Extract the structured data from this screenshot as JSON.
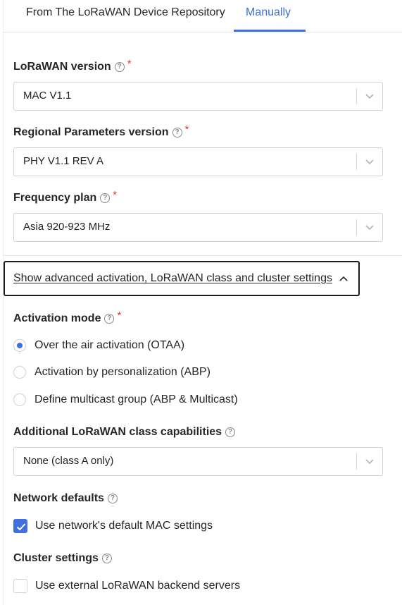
{
  "tabs": [
    {
      "label": "From The LoRaWAN Device Repository",
      "active": false
    },
    {
      "label": "Manually",
      "active": true
    }
  ],
  "fields": {
    "lorawan_version": {
      "label": "LoRaWAN version",
      "value": "MAC V1.1",
      "required": true
    },
    "regional_params": {
      "label": "Regional Parameters version",
      "value": "PHY V1.1 REV A",
      "required": true
    },
    "frequency_plan": {
      "label": "Frequency plan",
      "value": "Asia 920-923 MHz",
      "required": true
    }
  },
  "advanced_toggle": {
    "label": "Show advanced activation, LoRaWAN class and cluster settings",
    "expanded": true
  },
  "activation_mode": {
    "label": "Activation mode",
    "required": true,
    "options": [
      {
        "label": "Over the air activation (OTAA)",
        "selected": true
      },
      {
        "label": "Activation by personalization (ABP)",
        "selected": false
      },
      {
        "label": "Define multicast group (ABP & Multicast)",
        "selected": false
      }
    ]
  },
  "class_capabilities": {
    "label": "Additional LoRaWAN class capabilities",
    "value": "None (class A only)"
  },
  "network_defaults": {
    "label": "Network defaults",
    "checkbox_label": "Use network's default MAC settings",
    "checked": true
  },
  "cluster_settings": {
    "label": "Cluster settings",
    "checkbox_label": "Use external LoRaWAN backend servers",
    "checked": false
  },
  "colors": {
    "accent": "#3f6fe0",
    "required": "#e53935",
    "border": "#cfd2d6"
  },
  "icons": {
    "help": "help-circle-icon",
    "dropdown": "chevron-down-icon",
    "collapse": "chevron-up-icon",
    "check": "check-icon"
  }
}
